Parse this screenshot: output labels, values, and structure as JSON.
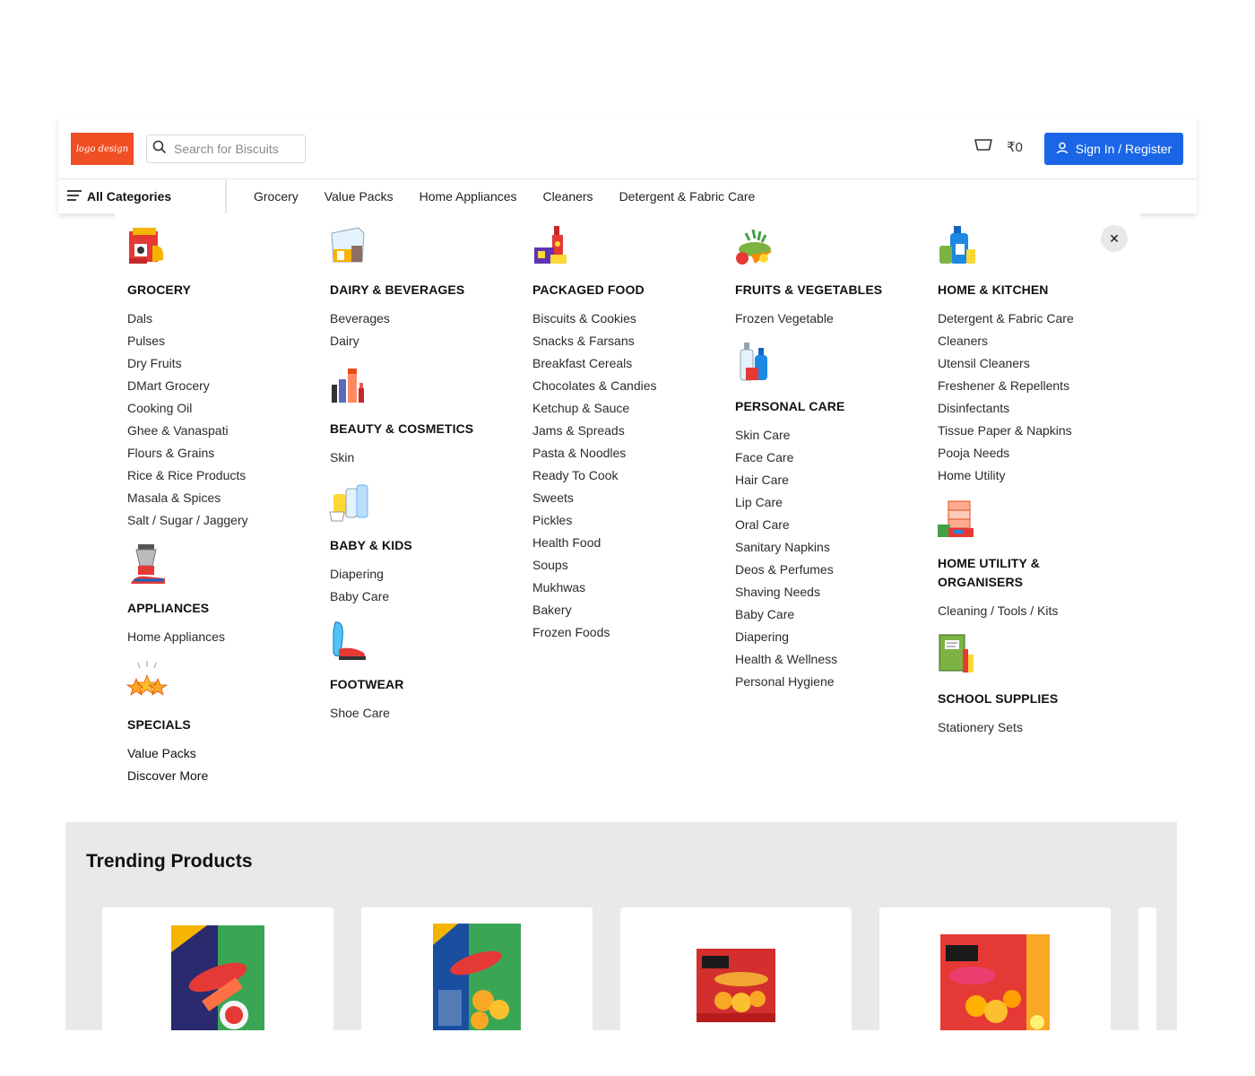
{
  "header": {
    "logo_text": "logo design",
    "search_placeholder": "Search for Biscuits",
    "cart_amount": "₹0",
    "signin_label": "Sign In / Register"
  },
  "nav": {
    "all_categories": "All Categories",
    "links": [
      "Grocery",
      "Value Packs",
      "Home Appliances",
      "Cleaners",
      "Detergent & Fabric Care"
    ]
  },
  "menu": {
    "grocery": {
      "title": "GROCERY",
      "items": [
        "Dals",
        "Pulses",
        "Dry Fruits",
        "DMart Grocery",
        "Cooking Oil",
        "Ghee & Vanaspati",
        "Flours & Grains",
        "Rice & Rice Products",
        "Masala & Spices",
        "Salt / Sugar / Jaggery"
      ]
    },
    "appliances": {
      "title": "APPLIANCES",
      "items": [
        "Home Appliances"
      ]
    },
    "specials": {
      "title": "SPECIALS",
      "items": [
        "Value Packs",
        "Discover More"
      ]
    },
    "dairy": {
      "title": "DAIRY & BEVERAGES",
      "items": [
        "Beverages",
        "Dairy"
      ]
    },
    "beauty": {
      "title": "BEAUTY & COSMETICS",
      "items": [
        "Skin"
      ]
    },
    "baby": {
      "title": "BABY & KIDS",
      "items": [
        "Diapering",
        "Baby Care"
      ]
    },
    "footwear": {
      "title": "FOOTWEAR",
      "items": [
        "Shoe Care"
      ]
    },
    "packaged": {
      "title": "PACKAGED FOOD",
      "items": [
        "Biscuits & Cookies",
        "Snacks & Farsans",
        "Breakfast Cereals",
        "Chocolates & Candies",
        "Ketchup & Sauce",
        "Jams & Spreads",
        "Pasta & Noodles",
        "Ready To Cook",
        "Sweets",
        "Pickles",
        "Health Food",
        "Soups",
        "Mukhwas",
        "Bakery",
        "Frozen Foods"
      ]
    },
    "fruits": {
      "title": "FRUITS & VEGETABLES",
      "items": [
        "Frozen Vegetable"
      ]
    },
    "personal": {
      "title": "PERSONAL CARE",
      "items": [
        "Skin Care",
        "Face Care",
        "Hair Care",
        "Lip Care",
        "Oral Care",
        "Sanitary Napkins",
        "Deos & Perfumes",
        "Shaving Needs",
        "Baby Care",
        "Diapering",
        "Health & Wellness",
        "Personal Hygiene"
      ]
    },
    "home_kitchen": {
      "title": "HOME & KITCHEN",
      "items": [
        "Detergent & Fabric Care",
        "Cleaners",
        "Utensil Cleaners",
        "Freshener & Repellents",
        "Disinfectants",
        "Tissue Paper & Napkins",
        "Pooja Needs",
        "Home Utility"
      ]
    },
    "home_utility": {
      "title": "HOME UTILITY & ORGANISERS",
      "items": [
        "Cleaning / Tools / Kits"
      ]
    },
    "school": {
      "title": "SCHOOL SUPPLIES",
      "items": [
        "Stationery Sets"
      ]
    }
  },
  "trending": {
    "title": "Trending Products"
  },
  "colors": {
    "brand_orange": "#f04e23",
    "primary_blue": "#1a66e6",
    "trending_bg": "#e9e9ec"
  }
}
